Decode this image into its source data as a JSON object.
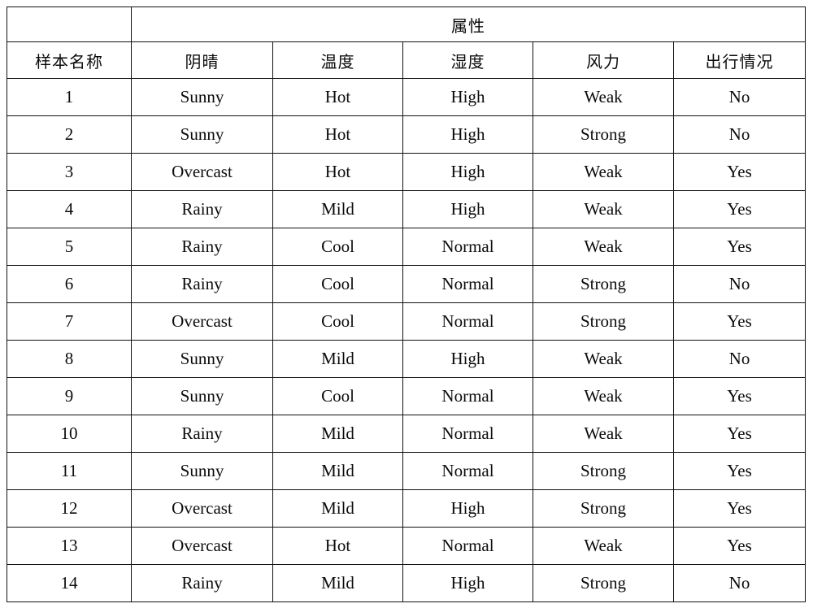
{
  "table": {
    "group_header": {
      "corner_label": "",
      "attributes_label": "属性",
      "attributes_colspan": 5
    },
    "columns": [
      {
        "key": "sample",
        "label": "样本名称"
      },
      {
        "key": "outlook",
        "label": "阴晴"
      },
      {
        "key": "temperature",
        "label": "温度"
      },
      {
        "key": "humidity",
        "label": "湿度"
      },
      {
        "key": "wind",
        "label": "风力"
      },
      {
        "key": "play",
        "label": "出行情况"
      }
    ],
    "rows": [
      {
        "sample": "1",
        "outlook": "Sunny",
        "temperature": "Hot",
        "humidity": "High",
        "wind": "Weak",
        "play": "No"
      },
      {
        "sample": "2",
        "outlook": "Sunny",
        "temperature": "Hot",
        "humidity": "High",
        "wind": "Strong",
        "play": "No"
      },
      {
        "sample": "3",
        "outlook": "Overcast",
        "temperature": "Hot",
        "humidity": "High",
        "wind": "Weak",
        "play": "Yes"
      },
      {
        "sample": "4",
        "outlook": "Rainy",
        "temperature": "Mild",
        "humidity": "High",
        "wind": "Weak",
        "play": "Yes"
      },
      {
        "sample": "5",
        "outlook": "Rainy",
        "temperature": "Cool",
        "humidity": "Normal",
        "wind": "Weak",
        "play": "Yes"
      },
      {
        "sample": "6",
        "outlook": "Rainy",
        "temperature": "Cool",
        "humidity": "Normal",
        "wind": "Strong",
        "play": "No"
      },
      {
        "sample": "7",
        "outlook": "Overcast",
        "temperature": "Cool",
        "humidity": "Normal",
        "wind": "Strong",
        "play": "Yes"
      },
      {
        "sample": "8",
        "outlook": "Sunny",
        "temperature": "Mild",
        "humidity": "High",
        "wind": "Weak",
        "play": "No"
      },
      {
        "sample": "9",
        "outlook": "Sunny",
        "temperature": "Cool",
        "humidity": "Normal",
        "wind": "Weak",
        "play": "Yes"
      },
      {
        "sample": "10",
        "outlook": "Rainy",
        "temperature": "Mild",
        "humidity": "Normal",
        "wind": "Weak",
        "play": "Yes"
      },
      {
        "sample": "11",
        "outlook": "Sunny",
        "temperature": "Mild",
        "humidity": "Normal",
        "wind": "Strong",
        "play": "Yes"
      },
      {
        "sample": "12",
        "outlook": "Overcast",
        "temperature": "Mild",
        "humidity": "High",
        "wind": "Strong",
        "play": "Yes"
      },
      {
        "sample": "13",
        "outlook": "Overcast",
        "temperature": "Hot",
        "humidity": "Normal",
        "wind": "Weak",
        "play": "Yes"
      },
      {
        "sample": "14",
        "outlook": "Rainy",
        "temperature": "Mild",
        "humidity": "High",
        "wind": "Strong",
        "play": "No"
      }
    ]
  },
  "style": {
    "border_color": "#111111",
    "text_color": "#0b0b0b",
    "background": "#ffffff"
  }
}
